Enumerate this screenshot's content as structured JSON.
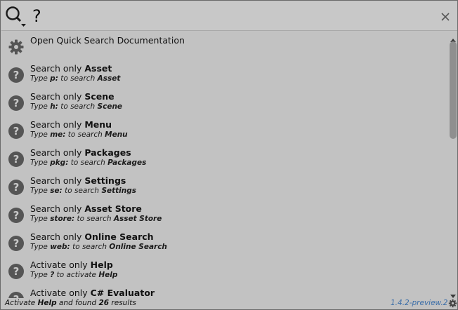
{
  "search": {
    "query": "?"
  },
  "results": [
    {
      "icon": "gear-icon",
      "label_prefix": "Open Quick Search Documentation",
      "label_bold": "",
      "desc_prefix": "",
      "desc_token": "",
      "desc_mid": "",
      "desc_target": ""
    },
    {
      "icon": "question-circle-icon",
      "label_prefix": "Search only ",
      "label_bold": "Asset",
      "desc_prefix": "Type ",
      "desc_token": "p:",
      "desc_mid": " to search ",
      "desc_target": "Asset"
    },
    {
      "icon": "question-circle-icon",
      "label_prefix": "Search only ",
      "label_bold": "Scene",
      "desc_prefix": "Type ",
      "desc_token": "h:",
      "desc_mid": " to search ",
      "desc_target": "Scene"
    },
    {
      "icon": "question-circle-icon",
      "label_prefix": "Search only ",
      "label_bold": "Menu",
      "desc_prefix": "Type ",
      "desc_token": "me:",
      "desc_mid": " to search ",
      "desc_target": "Menu"
    },
    {
      "icon": "question-circle-icon",
      "label_prefix": "Search only ",
      "label_bold": "Packages",
      "desc_prefix": "Type ",
      "desc_token": "pkg:",
      "desc_mid": " to search ",
      "desc_target": "Packages"
    },
    {
      "icon": "question-circle-icon",
      "label_prefix": "Search only ",
      "label_bold": "Settings",
      "desc_prefix": "Type ",
      "desc_token": "se:",
      "desc_mid": " to search ",
      "desc_target": "Settings"
    },
    {
      "icon": "question-circle-icon",
      "label_prefix": "Search only ",
      "label_bold": "Asset Store",
      "desc_prefix": "Type ",
      "desc_token": "store:",
      "desc_mid": " to search ",
      "desc_target": "Asset Store"
    },
    {
      "icon": "question-circle-icon",
      "label_prefix": "Search only ",
      "label_bold": "Online Search",
      "desc_prefix": "Type ",
      "desc_token": "web:",
      "desc_mid": " to search ",
      "desc_target": "Online Search"
    },
    {
      "icon": "question-circle-icon",
      "label_prefix": "Activate only ",
      "label_bold": "Help",
      "desc_prefix": "Type ",
      "desc_token": "?",
      "desc_mid": " to activate ",
      "desc_target": "Help"
    },
    {
      "icon": "question-circle-icon",
      "label_prefix": "Activate only ",
      "label_bold": "C# Evaluator",
      "desc_prefix": "",
      "desc_token": "",
      "desc_mid": "",
      "desc_target": ""
    }
  ],
  "status": {
    "prefix": "Activate ",
    "provider": "Help",
    "middle": " and found ",
    "count": "26",
    "suffix": " results",
    "version": "1.4.2-preview.2"
  },
  "colors": {
    "background": "#c2c2c2",
    "icon": "#555555",
    "link": "#3c6ea8",
    "scroll_thumb": "#8f8f8f"
  }
}
